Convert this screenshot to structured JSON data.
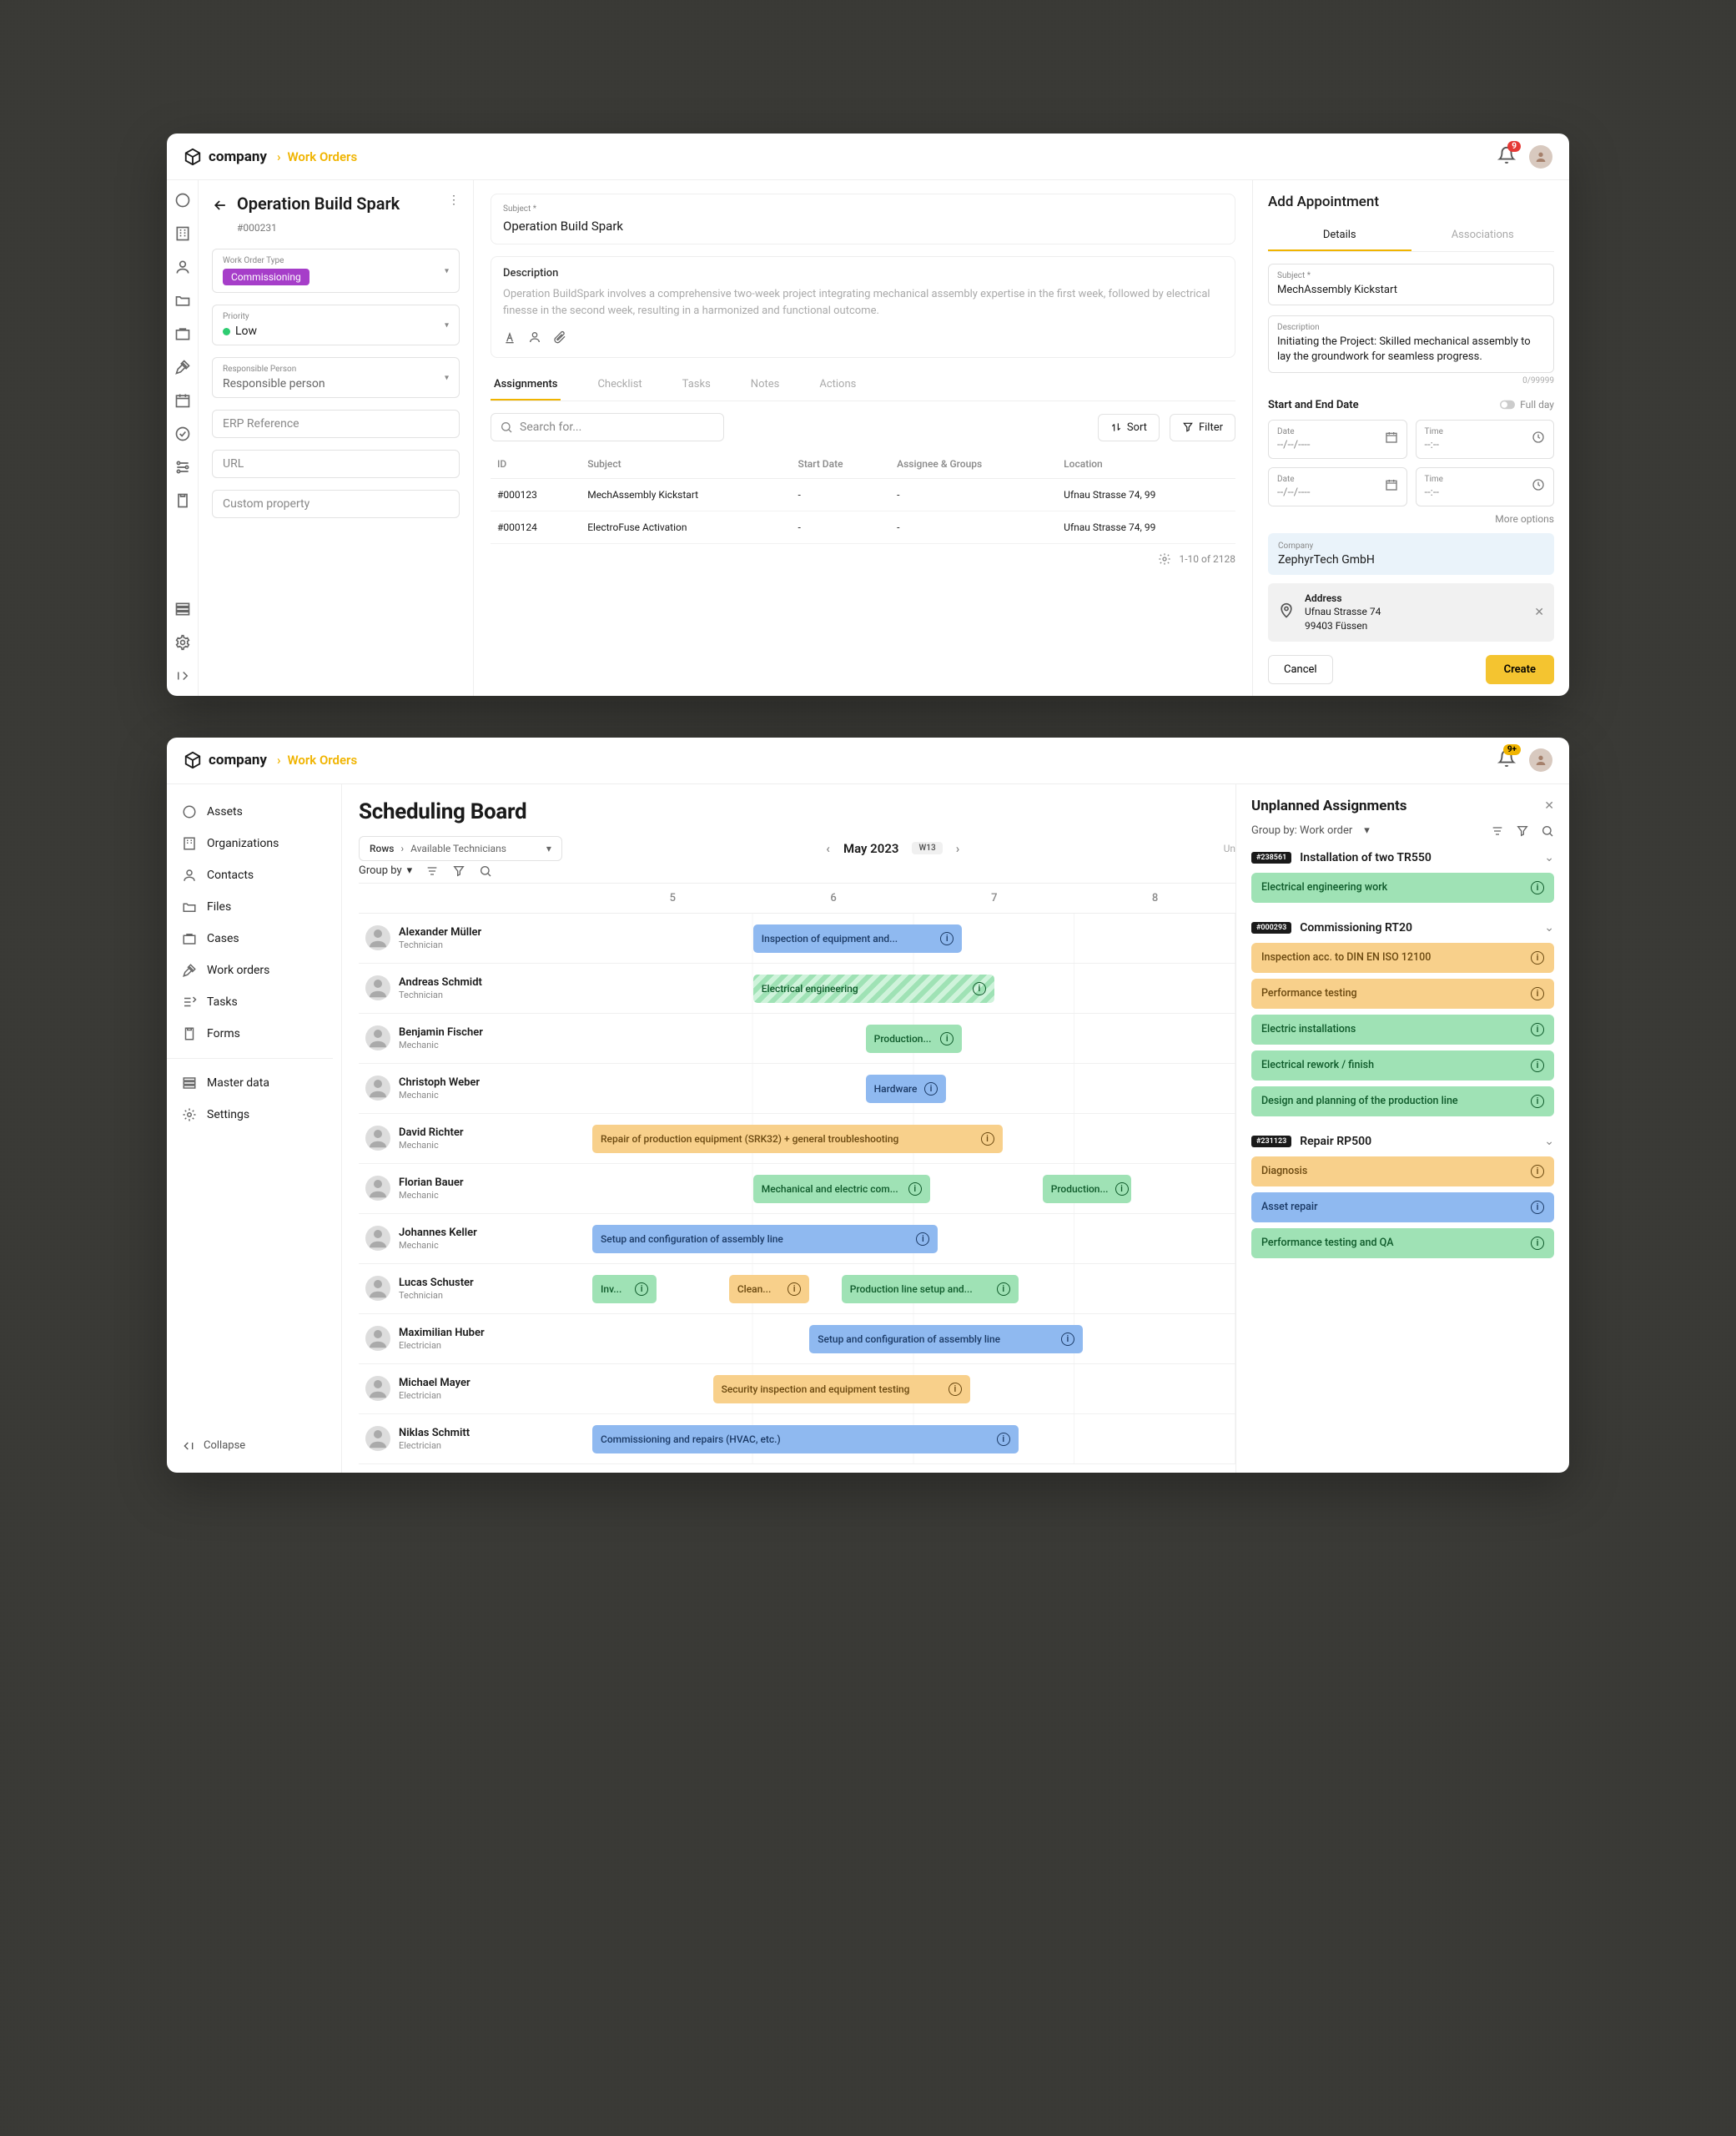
{
  "brand": "company",
  "breadcrumb": "Work Orders",
  "notif_count": "9",
  "notif_count_2": "9+",
  "app1": {
    "title": "Operation Build Spark",
    "wo_id": "#000231",
    "fields": {
      "type_label": "Work Order Type",
      "type_value": "Commissioning",
      "priority_label": "Priority",
      "priority_value": "Low",
      "responsible_label": "Responsible Person",
      "responsible_value": "Responsible person",
      "erp_label": "ERP Reference",
      "url_label": "URL",
      "custom_label": "Custom property"
    },
    "subject_label": "Subject *",
    "subject_value": "Operation Build Spark",
    "description_label": "Description",
    "description_value": "Operation BuildSpark involves a comprehensive two-week project integrating mechanical assembly expertise in the first week, followed by electrical finesse in the second week, resulting in a harmonized and functional outcome.",
    "tabs": [
      "Assignments",
      "Checklist",
      "Tasks",
      "Notes",
      "Actions"
    ],
    "search_placeholder": "Search for...",
    "sort_label": "Sort",
    "filter_label": "Filter",
    "cols": [
      "ID",
      "Subject",
      "Start Date",
      "Assignee & Groups",
      "Location"
    ],
    "rows": [
      {
        "id": "#000123",
        "subject": "MechAssembly Kickstart",
        "start": "-",
        "assignee": "-",
        "loc": "Ufnau Strasse 74, 99"
      },
      {
        "id": "#000124",
        "subject": "ElectroFuse Activation",
        "start": "-",
        "assignee": "-",
        "loc": "Ufnau Strasse 74, 99"
      }
    ],
    "paging": "1-10  of  2128"
  },
  "panel": {
    "title": "Add Appointment",
    "subtabs": [
      "Details",
      "Associations"
    ],
    "subject_label": "Subject *",
    "subject_value": "MechAssembly Kickstart",
    "desc_label": "Description",
    "desc_value": "Initiating the Project: Skilled mechanical assembly to lay the groundwork for seamless progress.",
    "counter": "0/99999",
    "section_label": "Start and End Date",
    "full_day_label": "Full day",
    "date_label": "Date",
    "date_placeholder": "--/--/----",
    "time_label": "Time",
    "time_placeholder": "--:--",
    "more_options": "More options",
    "company_label": "Company",
    "company_value": "ZephyrTech GmbH",
    "address_label": "Address",
    "address_line1": "Ufnau Strasse 74",
    "address_line2": "99403 Füssen",
    "cancel": "Cancel",
    "create": "Create"
  },
  "nav": {
    "items": [
      "Assets",
      "Organizations",
      "Contacts",
      "Files",
      "Cases",
      "Work orders",
      "Tasks",
      "Forms"
    ],
    "items2": [
      "Master data",
      "Settings"
    ],
    "collapse": "Collapse"
  },
  "board": {
    "title": "Scheduling Board",
    "rows_label": "Rows",
    "rows_value": "Available Technicians",
    "month": "May 2023",
    "week": "W13",
    "unlabel": "Un",
    "groupby_label": "Group by",
    "days": [
      "5",
      "6",
      "7",
      "8"
    ],
    "people": [
      {
        "name": "Alexander Müller",
        "role": "Technician",
        "bars": [
          {
            "c": "c-blue",
            "s": 1,
            "w": 1.3,
            "t": "Inspection of equipment and..."
          }
        ]
      },
      {
        "name": "Andreas Schmidt",
        "role": "Technician",
        "bars": [
          {
            "c": "c-green-h",
            "s": 1,
            "w": 1.5,
            "t": "Electrical engineering"
          }
        ]
      },
      {
        "name": "Benjamin Fischer",
        "role": "Mechanic",
        "bars": [
          {
            "c": "c-green",
            "s": 1.7,
            "w": 0.6,
            "t": "Production..."
          }
        ]
      },
      {
        "name": "Christoph Weber",
        "role": "Mechanic",
        "bars": [
          {
            "c": "c-blue",
            "s": 1.7,
            "w": 0.5,
            "t": "Hardware"
          }
        ]
      },
      {
        "name": "David Richter",
        "role": "Mechanic",
        "bars": [
          {
            "c": "c-orange",
            "s": 0,
            "w": 2.55,
            "t": "Repair of production equipment (SRK32) + general troubleshooting"
          }
        ]
      },
      {
        "name": "Florian Bauer",
        "role": "Mechanic",
        "bars": [
          {
            "c": "c-green",
            "s": 1,
            "w": 1.1,
            "t": "Mechanical and electric com..."
          },
          {
            "c": "c-green",
            "s": 2.8,
            "w": 0.55,
            "t": "Production..."
          }
        ]
      },
      {
        "name": "Johannes Keller",
        "role": "Mechanic",
        "bars": [
          {
            "c": "c-blue",
            "s": 0,
            "w": 2.15,
            "t": "Setup and configuration of assembly line"
          }
        ]
      },
      {
        "name": "Lucas Schuster",
        "role": "Technician",
        "bars": [
          {
            "c": "c-green",
            "s": 0,
            "w": 0.4,
            "t": "Inv..."
          },
          {
            "c": "c-orange",
            "s": 0.85,
            "w": 0.5,
            "t": "Clean..."
          },
          {
            "c": "c-green",
            "s": 1.55,
            "w": 1.1,
            "t": "Production line setup and..."
          }
        ]
      },
      {
        "name": "Maximilian Huber",
        "role": "Electrician",
        "bars": [
          {
            "c": "c-blue",
            "s": 1.35,
            "w": 1.7,
            "t": "Setup and configuration of assembly line"
          }
        ]
      },
      {
        "name": "Michael Mayer",
        "role": "Electrician",
        "bars": [
          {
            "c": "c-orange",
            "s": 0.75,
            "w": 1.6,
            "t": "Security inspection and equipment testing"
          }
        ]
      },
      {
        "name": "Niklas Schmitt",
        "role": "Electrician",
        "bars": [
          {
            "c": "c-blue",
            "s": 0,
            "w": 2.65,
            "t": "Commissioning and repairs (HVAC, etc.)"
          }
        ]
      }
    ]
  },
  "unplanned": {
    "title": "Unplanned Assignments",
    "groupby": "Group by: Work order",
    "groups": [
      {
        "id": "#238561",
        "name": "Installation of two TR550",
        "open": false,
        "tasks": [
          {
            "c": "c-green",
            "t": "Electrical engineering work"
          }
        ]
      },
      {
        "id": "#000293",
        "name": "Commissioning RT20",
        "open": true,
        "tasks": [
          {
            "c": "c-orange",
            "t": "Inspection acc. to DIN EN ISO 12100"
          },
          {
            "c": "c-orange",
            "t": "Performance testing"
          },
          {
            "c": "c-green",
            "t": "Electric installations"
          },
          {
            "c": "c-green",
            "t": "Electrical rework / finish"
          },
          {
            "c": "c-green",
            "t": "Design and planning of the production line"
          }
        ]
      },
      {
        "id": "#231123",
        "name": "Repair RP500",
        "open": true,
        "tasks": [
          {
            "c": "c-orange",
            "t": "Diagnosis"
          },
          {
            "c": "c-blue",
            "t": "Asset repair"
          },
          {
            "c": "c-green",
            "t": "Performance testing and QA"
          }
        ]
      }
    ]
  }
}
